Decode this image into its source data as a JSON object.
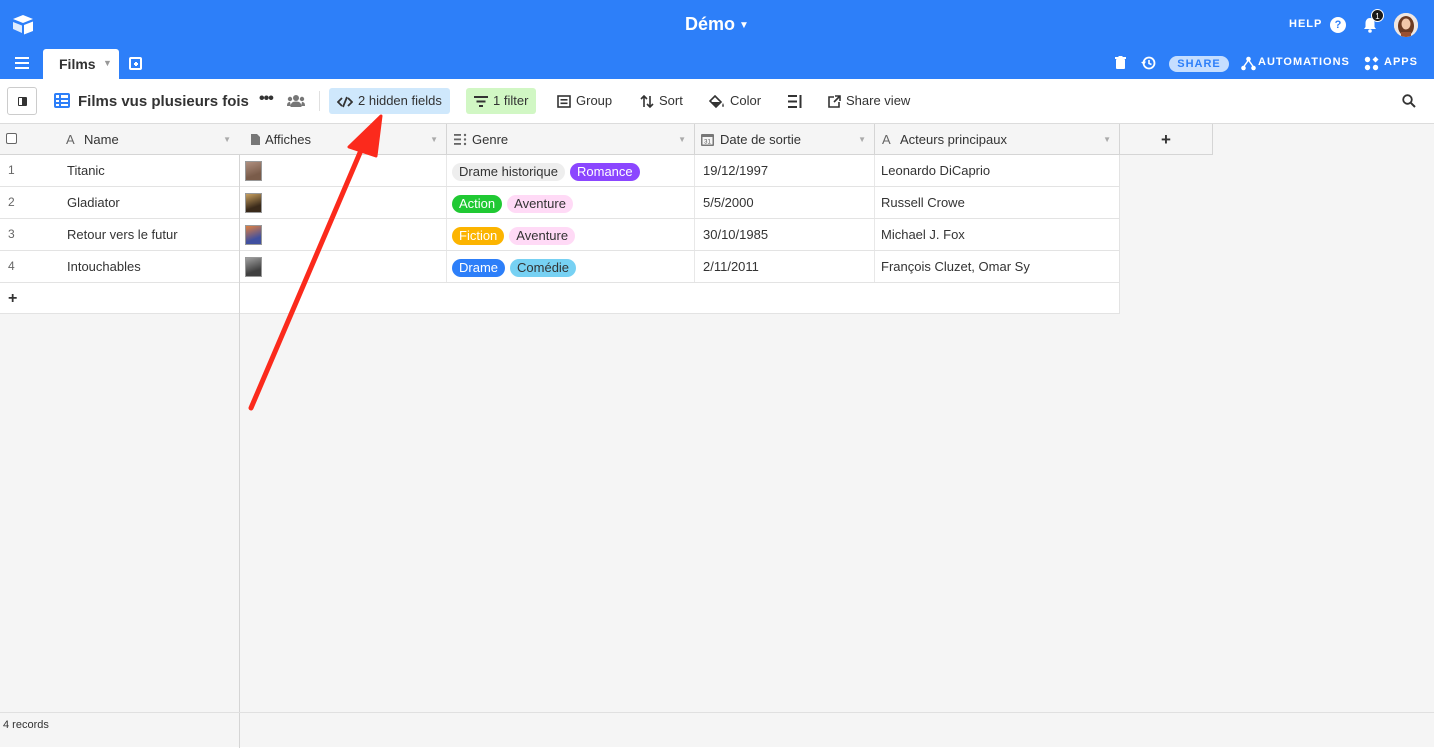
{
  "header": {
    "base_title": "Démo",
    "help_label": "HELP",
    "notification_count": "1",
    "tab_label": "Films",
    "share_label": "SHARE",
    "automations_label": "AUTOMATIONS",
    "apps_label": "APPS",
    "brand_color": "#2d7ff9"
  },
  "viewbar": {
    "view_name": "Films vus plusieurs fois",
    "hidden_fields": "2 hidden fields",
    "filter": "1 filter",
    "group": "Group",
    "sort": "Sort",
    "color": "Color",
    "share_view": "Share view"
  },
  "columns": {
    "name": "Name",
    "affiches": "Affiches",
    "genre": "Genre",
    "date": "Date de sortie",
    "acteurs": "Acteurs principaux",
    "add": "+"
  },
  "rows": [
    {
      "num": "1",
      "name": "Titanic",
      "genres": [
        {
          "label": "Drame historique",
          "bg": "#eeeeee",
          "fg": "#333333"
        },
        {
          "label": "Romance",
          "bg": "#8b46ff",
          "fg": "#ffffff"
        }
      ],
      "date": "19/12/1997",
      "acteurs": "Leonardo DiCaprio",
      "thumb": [
        "#7a5c4a",
        "#b09080"
      ]
    },
    {
      "num": "2",
      "name": "Gladiator",
      "genres": [
        {
          "label": "Action",
          "bg": "#20c933",
          "fg": "#ffffff"
        },
        {
          "label": "Aventure",
          "bg": "#ffdaf6",
          "fg": "#333333"
        }
      ],
      "date": "5/5/2000",
      "acteurs": "Russell Crowe",
      "thumb": [
        "#3a2a1a",
        "#c8a060"
      ]
    },
    {
      "num": "3",
      "name": "Retour vers le futur",
      "genres": [
        {
          "label": "Fiction",
          "bg": "#fcb400",
          "fg": "#ffffff"
        },
        {
          "label": "Aventure",
          "bg": "#ffdaf6",
          "fg": "#333333"
        }
      ],
      "date": "30/10/1985",
      "acteurs": "Michael J. Fox",
      "thumb": [
        "#4050a0",
        "#e08040"
      ]
    },
    {
      "num": "4",
      "name": "Intouchables",
      "genres": [
        {
          "label": "Drame",
          "bg": "#2d7ff9",
          "fg": "#ffffff"
        },
        {
          "label": "Comédie",
          "bg": "#77d1f3",
          "fg": "#333333"
        }
      ],
      "date": "2/11/2011",
      "acteurs": "François Cluzet, Omar Sy",
      "thumb": [
        "#404040",
        "#a0a0a0"
      ]
    }
  ],
  "add_row": "+",
  "footer": {
    "records": "4 records"
  }
}
